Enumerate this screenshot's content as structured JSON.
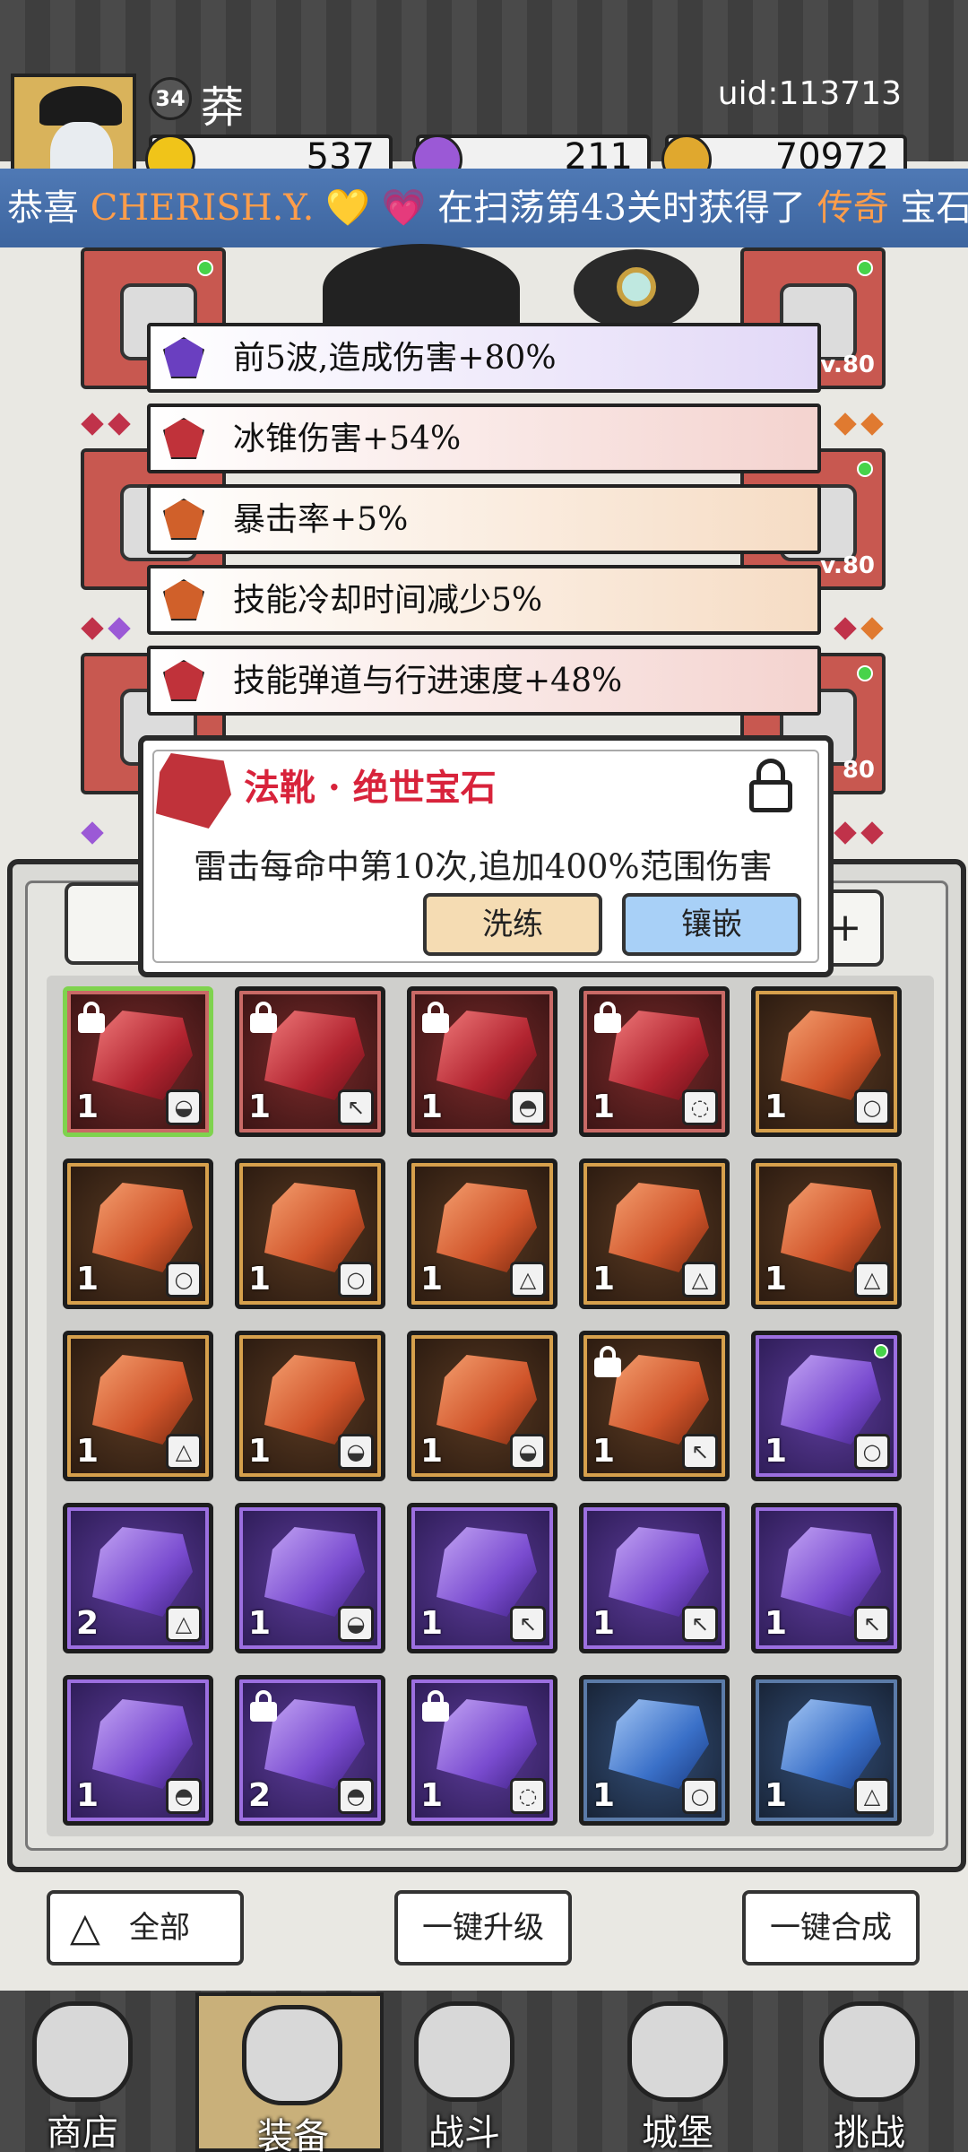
{
  "header": {
    "level": "34",
    "player_name": "莽",
    "uid": "uid:113713",
    "resources": [
      {
        "value": "537",
        "icon": "gold-gem-icon",
        "color": "#f0c419"
      },
      {
        "value": "211",
        "icon": "purple-diamond-icon",
        "color": "#9b59d6"
      },
      {
        "value": "70972",
        "icon": "gold-coin-icon",
        "color": "#e0a82e"
      }
    ]
  },
  "ticker": {
    "prefix": "恭喜",
    "player": "CHERISH.Y.",
    "hearts": [
      "💛",
      "💗"
    ],
    "middle": "在扫荡第43关时获得了",
    "rarity": "传奇",
    "suffix": "宝石"
  },
  "equipment": {
    "left": [
      {
        "icon": "helmet-icon"
      },
      {
        "icon": "scarf-icon"
      },
      {
        "icon": "boot-icon"
      }
    ],
    "right": [
      {
        "icon": "wand-icon",
        "level": "v.80"
      },
      {
        "icon": "ring-icon",
        "level": "v.80"
      },
      {
        "icon": "necklace-icon",
        "level": "80"
      }
    ]
  },
  "stats": [
    {
      "text": "前5波,造成伤害+80%",
      "rarity": "purple",
      "bg": "#ece6f8"
    },
    {
      "text": "冰锥伤害+54%",
      "rarity": "red",
      "bg": "#f7e1de"
    },
    {
      "text": "暴击率+5%",
      "rarity": "orange",
      "bg": "#f9e6d6"
    },
    {
      "text": "技能冷却时间减少5%",
      "rarity": "orange",
      "bg": "#f9e6d6"
    },
    {
      "text": "技能弹道与行进速度+48%",
      "rarity": "red",
      "bg": "#f7e1de"
    }
  ],
  "tooltip": {
    "title": "法靴 · 绝世宝石",
    "description": "雷击每命中第10次,追加400%范围伤害",
    "refine_label": "洗练",
    "inlay_label": "镶嵌"
  },
  "inventory": {
    "plus_label": "+",
    "rows": [
      [
        {
          "rarity": "red",
          "count": "1",
          "slot": "boot",
          "slot_glyph": "◒",
          "locked": true,
          "selected": true
        },
        {
          "rarity": "red",
          "count": "1",
          "slot": "wand",
          "slot_glyph": "↖",
          "locked": true
        },
        {
          "rarity": "red",
          "count": "1",
          "slot": "hat",
          "slot_glyph": "◓",
          "locked": true
        },
        {
          "rarity": "red",
          "count": "1",
          "slot": "necklace",
          "slot_glyph": "◌",
          "locked": true
        },
        {
          "rarity": "orange",
          "count": "1",
          "slot": "ring",
          "slot_glyph": "○",
          "locked": false
        }
      ],
      [
        {
          "rarity": "orange",
          "count": "1",
          "slot": "ring",
          "slot_glyph": "○",
          "locked": false
        },
        {
          "rarity": "orange",
          "count": "1",
          "slot": "ring",
          "slot_glyph": "○",
          "locked": false
        },
        {
          "rarity": "orange",
          "count": "1",
          "slot": "cloak",
          "slot_glyph": "△",
          "locked": false
        },
        {
          "rarity": "orange",
          "count": "1",
          "slot": "cloak",
          "slot_glyph": "△",
          "locked": false
        },
        {
          "rarity": "orange",
          "count": "1",
          "slot": "cloak",
          "slot_glyph": "△",
          "locked": false
        }
      ],
      [
        {
          "rarity": "orange",
          "count": "1",
          "slot": "cloak",
          "slot_glyph": "△",
          "locked": false
        },
        {
          "rarity": "orange",
          "count": "1",
          "slot": "boot",
          "slot_glyph": "◒",
          "locked": false
        },
        {
          "rarity": "orange",
          "count": "1",
          "slot": "boot",
          "slot_glyph": "◒",
          "locked": false
        },
        {
          "rarity": "orange",
          "count": "1",
          "slot": "wand",
          "slot_glyph": "↖",
          "locked": true
        },
        {
          "rarity": "purple",
          "count": "1",
          "slot": "ring",
          "slot_glyph": "○",
          "locked": false,
          "new": true
        }
      ],
      [
        {
          "rarity": "purple",
          "count": "2",
          "slot": "cloak",
          "slot_glyph": "△",
          "locked": false
        },
        {
          "rarity": "purple",
          "count": "1",
          "slot": "boot",
          "slot_glyph": "◒",
          "locked": false
        },
        {
          "rarity": "purple",
          "count": "1",
          "slot": "wand",
          "slot_glyph": "↖",
          "locked": false
        },
        {
          "rarity": "purple",
          "count": "1",
          "slot": "wand",
          "slot_glyph": "↖",
          "locked": false
        },
        {
          "rarity": "purple",
          "count": "1",
          "slot": "wand",
          "slot_glyph": "↖",
          "locked": false
        }
      ],
      [
        {
          "rarity": "purple",
          "count": "1",
          "slot": "hat",
          "slot_glyph": "◓",
          "locked": false
        },
        {
          "rarity": "purple",
          "count": "2",
          "slot": "hat",
          "slot_glyph": "◓",
          "locked": true
        },
        {
          "rarity": "purple",
          "count": "1",
          "slot": "necklace",
          "slot_glyph": "◌",
          "locked": true
        },
        {
          "rarity": "blue",
          "count": "1",
          "slot": "ring",
          "slot_glyph": "○",
          "locked": false
        },
        {
          "rarity": "blue",
          "count": "1",
          "slot": "cloak",
          "slot_glyph": "△",
          "locked": false
        }
      ]
    ]
  },
  "actions": {
    "filter_label": "全部",
    "upgrade_all_label": "一键升级",
    "merge_all_label": "一键合成"
  },
  "nav": [
    {
      "label": "商店",
      "icon": "shop-icon",
      "active": false
    },
    {
      "label": "装备",
      "icon": "backpack-icon",
      "active": true
    },
    {
      "label": "战斗",
      "icon": "crossed-swords-icon",
      "active": false
    },
    {
      "label": "城堡",
      "icon": "castle-icon",
      "active": false
    },
    {
      "label": "挑战",
      "icon": "shield-icon",
      "active": false
    }
  ]
}
